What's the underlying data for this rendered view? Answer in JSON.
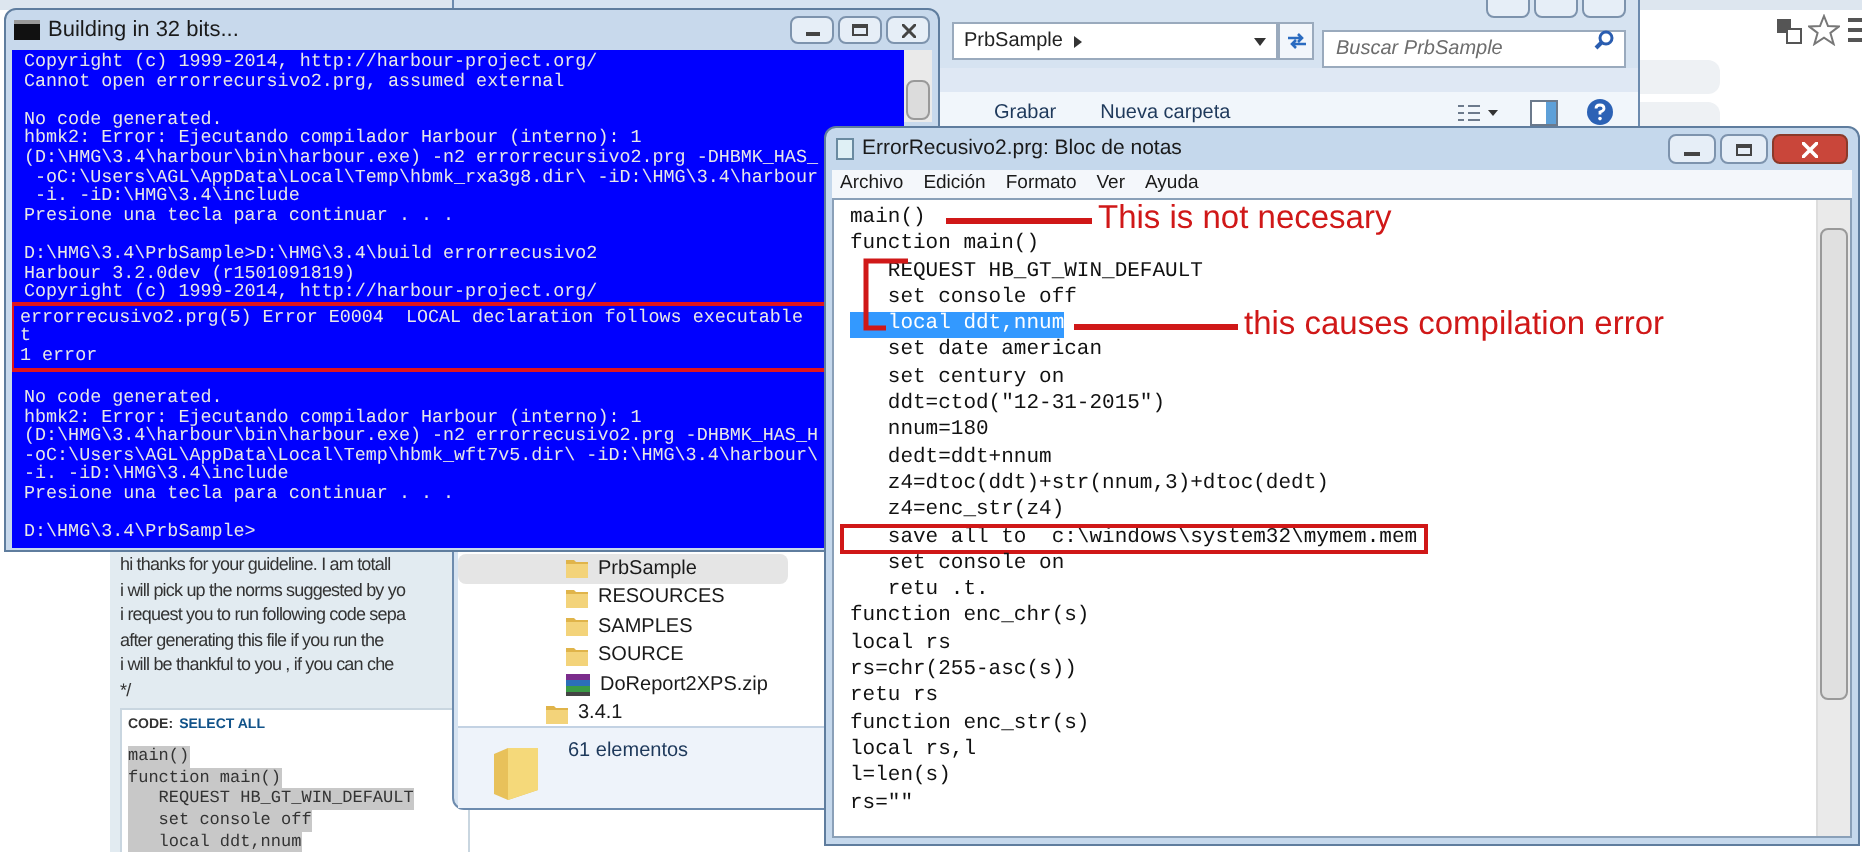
{
  "console": {
    "title": "Building in 32 bits...",
    "sections": [
      {
        "boxed": false,
        "lines": [
          {
            "kind": "text",
            "text": "Copyright (c) 1999-2014, http://harbour-project.org/"
          },
          {
            "kind": "text",
            "text": "Cannot open errorrecursivo2.prg, assumed external"
          },
          {
            "kind": "blank"
          },
          {
            "kind": "text",
            "text": "No code generated."
          },
          {
            "kind": "text",
            "text": "hbmk2: Error: Ejecutando compilador Harbour (interno): 1"
          },
          {
            "kind": "text",
            "text": "(D:\\HMG\\3.4\\harbour\\bin\\harbour.exe) -n2 errorrecursivo2.prg -DHBMK_HAS_"
          },
          {
            "kind": "text",
            "text": " -oC:\\Users\\AGL\\AppData\\Local\\Temp\\hbmk_rxa3g8.dir\\ -iD:\\HMG\\3.4\\harbour"
          },
          {
            "kind": "text",
            "text": " -i. -iD:\\HMG\\3.4\\include"
          },
          {
            "kind": "text",
            "text": "Presione una tecla para continuar . . ."
          },
          {
            "kind": "blank"
          },
          {
            "kind": "text",
            "text": "D:\\HMG\\3.4\\PrbSample>D:\\HMG\\3.4\\build errorrecusivo2"
          },
          {
            "kind": "text",
            "text": "Harbour 3.2.0dev (r1501091819)"
          },
          {
            "kind": "text",
            "text": "Copyright (c) 1999-2014, http://harbour-project.org/"
          }
        ]
      },
      {
        "boxed": true,
        "lines": [
          {
            "kind": "text",
            "text": "errorrecusivo2.prg(5) Error E0004  LOCAL declaration follows executable"
          },
          {
            "kind": "text",
            "text": "t"
          },
          {
            "kind": "text",
            "text": "1 error"
          }
        ]
      },
      {
        "boxed": false,
        "lines": [
          {
            "kind": "blank"
          },
          {
            "kind": "text",
            "text": "No code generated."
          },
          {
            "kind": "text",
            "text": "hbmk2: Error: Ejecutando compilador Harbour (interno): 1"
          },
          {
            "kind": "text",
            "text": "(D:\\HMG\\3.4\\harbour\\bin\\harbour.exe) -n2 errorrecusivo2.prg -DHBMK_HAS_H"
          },
          {
            "kind": "text",
            "text": "-oC:\\Users\\AGL\\AppData\\Local\\Temp\\hbmk_wft7v5.dir\\ -iD:\\HMG\\3.4\\harbour\\"
          },
          {
            "kind": "text",
            "text": "-i. -iD:\\HMG\\3.4\\include"
          },
          {
            "kind": "text",
            "text": "Presione una tecla para continuar . . ."
          },
          {
            "kind": "blank"
          },
          {
            "kind": "text",
            "text": "D:\\HMG\\3.4\\PrbSample>"
          }
        ]
      }
    ]
  },
  "explorer": {
    "address": "PrbSample",
    "search": {
      "placeholder": "Buscar PrbSample"
    },
    "toolbar": [
      "Grabar",
      "Nueva carpeta"
    ],
    "tree": [
      {
        "children": [
          {
            "label": "PrbSample",
            "kind": "folder",
            "selected": true
          },
          {
            "label": "RESOURCES",
            "kind": "folder",
            "selected": false
          },
          {
            "label": "SAMPLES",
            "kind": "folder",
            "selected": false
          },
          {
            "label": "SOURCE",
            "kind": "folder",
            "selected": false
          },
          {
            "label": "DoReport2XPS.zip",
            "kind": "archive",
            "selected": false
          }
        ]
      },
      {
        "label": "3.4.1",
        "kind": "folder",
        "selected": false
      }
    ],
    "status": "61 elementos"
  },
  "forum": {
    "lines": [
      "hi thanks for your guideline. I am totall",
      "i will pick up the norms suggested by yo",
      "i request you to run following code sepa",
      "after generating this file if you run the",
      "i will be thankful to you , if you can che",
      "*/"
    ],
    "code_box": {
      "label": "CODE:",
      "link": "SELECT ALL",
      "lines": [
        {
          "text": "main()",
          "selected": true
        },
        {
          "text": "function main()",
          "selected": true
        },
        {
          "text": "   REQUEST HB_GT_WIN_DEFAULT",
          "selected": true
        },
        {
          "text": "   set console off",
          "selected": true
        },
        {
          "text": "   local ddt,nnum",
          "selected": true
        }
      ]
    }
  },
  "notepad": {
    "title": "ErrorRecusivo2.prg: Bloc de notas",
    "menu": [
      "Archivo",
      "Edición",
      "Formato",
      "Ver",
      "Ayuda"
    ],
    "lines": [
      {
        "text": "main()",
        "selected": false,
        "boxed": false
      },
      {
        "text": "function main()",
        "selected": false,
        "boxed": false
      },
      {
        "text": "   REQUEST HB_GT_WIN_DEFAULT",
        "selected": false,
        "boxed": false
      },
      {
        "text": "   set console off",
        "selected": false,
        "boxed": false
      },
      {
        "text": "   local ddt,nnum",
        "selected": true,
        "boxed": false
      },
      {
        "text": "   set date american",
        "selected": false,
        "boxed": false
      },
      {
        "text": "   set century on",
        "selected": false,
        "boxed": false
      },
      {
        "text": "   ddt=ctod(\"12-31-2015\")",
        "selected": false,
        "boxed": false
      },
      {
        "text": "   nnum=180",
        "selected": false,
        "boxed": false
      },
      {
        "text": "   dedt=ddt+nnum",
        "selected": false,
        "boxed": false
      },
      {
        "text": "   z4=dtoc(ddt)+str(nnum,3)+dtoc(dedt)",
        "selected": false,
        "boxed": false
      },
      {
        "text": "   z4=enc_str(z4)",
        "selected": false,
        "boxed": false
      },
      {
        "text": "   save all to  c:\\windows\\system32\\mymem.mem",
        "selected": false,
        "boxed": true
      },
      {
        "text": "   set console on",
        "selected": false,
        "boxed": false
      },
      {
        "text": "   retu .t.",
        "selected": false,
        "boxed": false
      },
      {
        "text": "function enc_chr(s)",
        "selected": false,
        "boxed": false
      },
      {
        "text": "local rs",
        "selected": false,
        "boxed": false
      },
      {
        "text": "rs=chr(255-asc(s))",
        "selected": false,
        "boxed": false
      },
      {
        "text": "retu rs",
        "selected": false,
        "boxed": false
      },
      {
        "text": "function enc_str(s)",
        "selected": false,
        "boxed": false
      },
      {
        "text": "local rs,l",
        "selected": false,
        "boxed": false
      },
      {
        "text": "l=len(s)",
        "selected": false,
        "boxed": false
      },
      {
        "text": "rs=\"\"",
        "selected": false,
        "boxed": false
      }
    ]
  },
  "annotations": [
    {
      "text": "This is not necesary"
    },
    {
      "text": "this causes compilation error"
    }
  ]
}
